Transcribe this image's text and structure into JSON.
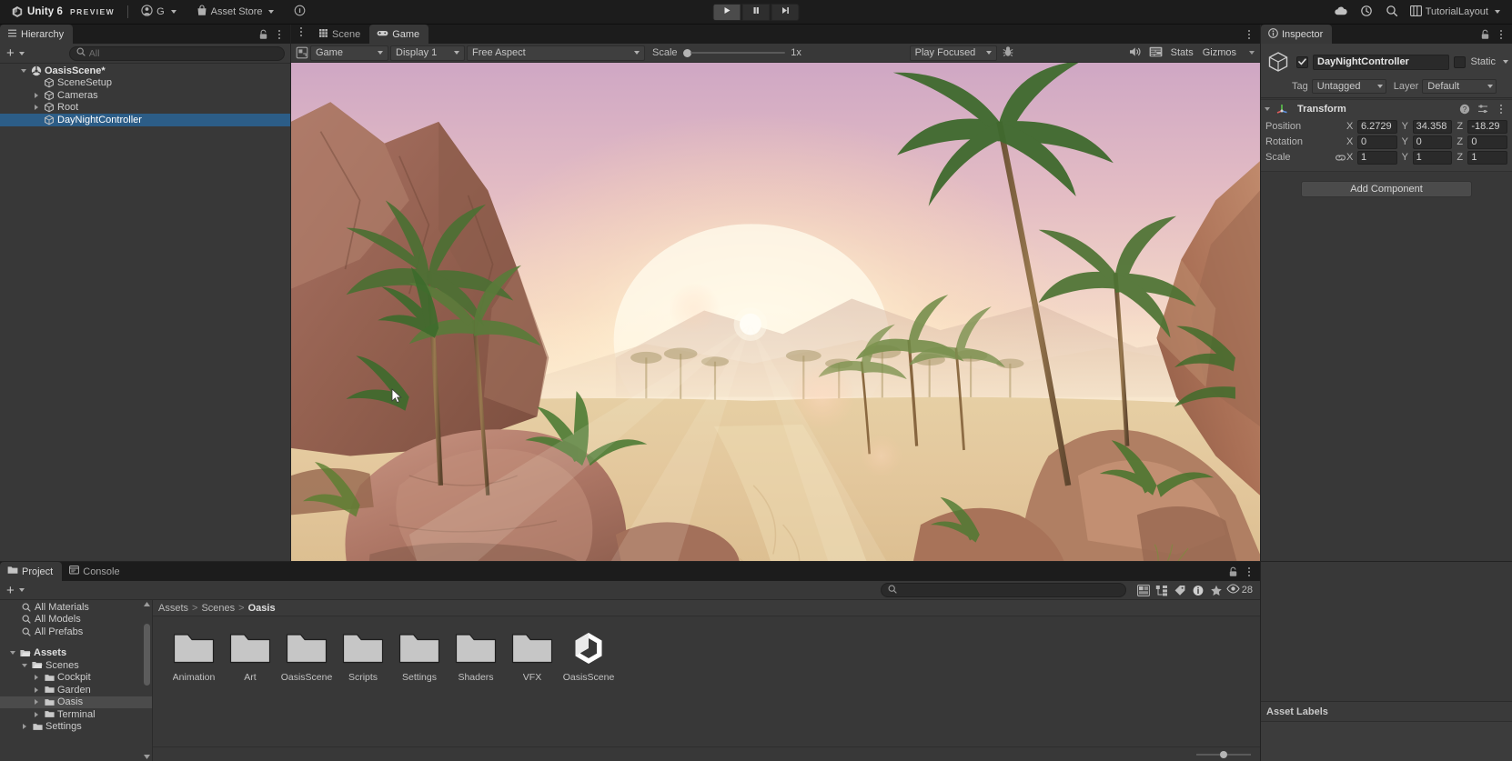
{
  "toolbar": {
    "brand": "Unity 6",
    "preview": "PREVIEW",
    "account_label": "G",
    "asset_store_label": "Asset Store",
    "cloud_icon": "cloud-icon",
    "history_icon": "history-icon",
    "search_icon": "search-icon",
    "layout_label": "TutorialLayout",
    "play_icon": "play-icon",
    "pause_icon": "pause-icon",
    "step_icon": "step-icon"
  },
  "hierarchy": {
    "tab_label": "Hierarchy",
    "search_placeholder": "All",
    "items": [
      {
        "label": "OasisScene*",
        "depth": 0,
        "twisty": "open",
        "icon": "scene-icon",
        "bold": true,
        "selected": false
      },
      {
        "label": "SceneSetup",
        "depth": 1,
        "twisty": "none",
        "icon": "gameobject-icon",
        "bold": false,
        "selected": false
      },
      {
        "label": "Cameras",
        "depth": 1,
        "twisty": "closed",
        "icon": "gameobject-icon",
        "bold": false,
        "selected": false
      },
      {
        "label": "Root",
        "depth": 1,
        "twisty": "closed",
        "icon": "gameobject-icon",
        "bold": false,
        "selected": false
      },
      {
        "label": "DayNightController",
        "depth": 1,
        "twisty": "none",
        "icon": "gameobject-icon",
        "bold": false,
        "selected": true
      }
    ]
  },
  "gameview": {
    "tabs": [
      {
        "label": "Scene",
        "icon": "scene-grid-icon",
        "active": false
      },
      {
        "label": "Game",
        "icon": "game-pad-icon",
        "active": true
      }
    ],
    "target_display": "Game",
    "display": "Display 1",
    "aspect": "Free Aspect",
    "scale_label": "Scale",
    "scale_value": "1x",
    "play_mode": "Play Focused",
    "mute_icon": "mute-audio-icon",
    "stats_label": "Stats",
    "gizmos_label": "Gizmos",
    "bug_icon": "bug-icon",
    "stats_icon": "stats-icon"
  },
  "inspector": {
    "tab_label": "Inspector",
    "object_name": "DayNightController",
    "enabled": true,
    "static_label": "Static",
    "tag_label": "Tag",
    "tag_value": "Untagged",
    "layer_label": "Layer",
    "layer_value": "Default",
    "component": {
      "title": "Transform",
      "rows": [
        {
          "label": "Position",
          "x": "6.2729",
          "y": "34.358",
          "z": "-18.29",
          "link": false
        },
        {
          "label": "Rotation",
          "x": "0",
          "y": "0",
          "z": "0",
          "link": false
        },
        {
          "label": "Scale",
          "x": "1",
          "y": "1",
          "z": "1",
          "link": true
        }
      ],
      "axis_labels": [
        "X",
        "Y",
        "Z"
      ]
    },
    "add_component_label": "Add Component",
    "asset_labels_title": "Asset Labels"
  },
  "project": {
    "tabs": [
      {
        "label": "Project",
        "icon": "folder-icon",
        "active": true
      },
      {
        "label": "Console",
        "icon": "console-icon",
        "active": false
      }
    ],
    "search_placeholder": "",
    "favorites": [
      {
        "label": "All Materials",
        "icon": "search-icon"
      },
      {
        "label": "All Models",
        "icon": "search-icon"
      },
      {
        "label": "All Prefabs",
        "icon": "search-icon"
      }
    ],
    "tree": [
      {
        "label": "Assets",
        "depth": 0,
        "twisty": "open",
        "bold": true,
        "selected": false
      },
      {
        "label": "Scenes",
        "depth": 1,
        "twisty": "open",
        "bold": false,
        "selected": false
      },
      {
        "label": "Cockpit",
        "depth": 2,
        "twisty": "closed",
        "bold": false,
        "selected": false
      },
      {
        "label": "Garden",
        "depth": 2,
        "twisty": "closed",
        "bold": false,
        "selected": false
      },
      {
        "label": "Oasis",
        "depth": 2,
        "twisty": "closed",
        "bold": false,
        "selected": true
      },
      {
        "label": "Terminal",
        "depth": 2,
        "twisty": "closed",
        "bold": false,
        "selected": false
      },
      {
        "label": "Settings",
        "depth": 1,
        "twisty": "closed",
        "bold": false,
        "selected": false
      }
    ],
    "breadcrumb": [
      "Assets",
      "Scenes",
      "Oasis"
    ],
    "assets": [
      {
        "label": "Animation",
        "type": "folder"
      },
      {
        "label": "Art",
        "type": "folder"
      },
      {
        "label": "OasisScene",
        "type": "folder"
      },
      {
        "label": "Scripts",
        "type": "folder"
      },
      {
        "label": "Settings",
        "type": "folder"
      },
      {
        "label": "Shaders",
        "type": "folder"
      },
      {
        "label": "VFX",
        "type": "folder"
      },
      {
        "label": "OasisScene",
        "type": "unity-scene"
      }
    ],
    "visible_count": "28",
    "toolbar_icons": [
      "two-column-layout-icon",
      "hierarchy-icon",
      "label-icon",
      "info-icon",
      "star-icon",
      "eye-icon"
    ]
  },
  "colors": {
    "selection_blue": "#2c5d87",
    "panel_bg": "#383838",
    "toolbar_bg": "#1c1c1c",
    "field_bg": "#2a2a2a",
    "text": "#c4c4c4"
  }
}
